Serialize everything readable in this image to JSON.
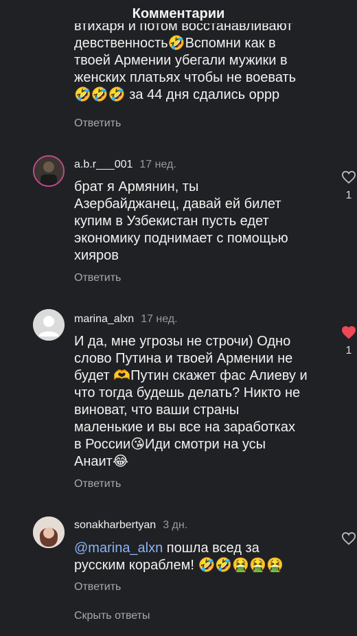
{
  "header": {
    "title": "Комментарии"
  },
  "comment0": {
    "lines": [
      "втихаря и потом восстанавливают",
      "девственность🤣Вспомни как в",
      "твоей Армении убегали мужики в",
      "женских платьях чтобы не воевать",
      "🤣🤣🤣 за 44 дня сдались оррр"
    ],
    "reply_label": "Ответить"
  },
  "comment1": {
    "username": "a.b.r___001",
    "time": "17 нед.",
    "lines": [
      "брат я Армянин, ты",
      "Азербайджанец, давай ей билет",
      "купим в Узбекистан пусть едет",
      "экономику поднимает с помощью",
      "хияров"
    ],
    "reply_label": "Ответить",
    "likes": "1"
  },
  "comment2": {
    "username": "marina_alxn",
    "time": "17 нед.",
    "lines": [
      "И да, мне угрозы не строчи) Одно",
      "слово Путина и твоей Армении не",
      "будет 🫶Путин скажет фас Алиеву и",
      "что тогда будешь делать? Никто не",
      "виноват, что ваши страны",
      "маленькие и вы все на заработках",
      "в России😘Иди смотри на усы",
      "Анаит😂"
    ],
    "reply_label": "Ответить",
    "likes": "1"
  },
  "comment3": {
    "username": "sonakharbertyan",
    "time": "3 дн.",
    "mention": "@marina_alxn",
    "text1": " пошла всед за",
    "text2": "русским кораблем! 🤣🤣🤮🤮🤮",
    "reply_label": "Ответить"
  },
  "hide_replies": "Скрыть ответы",
  "colors": {
    "background": "#202124",
    "like_active": "#ed4956",
    "mention": "#8ab4f8"
  },
  "icons": [
    "heart-outline-icon",
    "heart-filled-icon",
    "avatar-default-icon"
  ]
}
